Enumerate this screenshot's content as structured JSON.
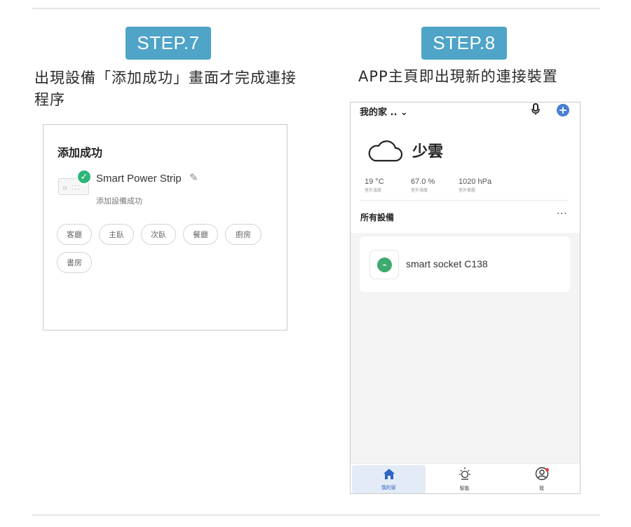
{
  "step7": {
    "badge": "STEP.7",
    "caption": "出現設備「添加成功」畫面才完成連接程序",
    "screen": {
      "title": "添加成功",
      "device_name": "Smart Power Strip",
      "device_status": "添加設備成功",
      "rooms": [
        "客廳",
        "主臥",
        "次臥",
        "餐廳",
        "廚房",
        "書房"
      ]
    }
  },
  "step8": {
    "badge": "STEP.8",
    "caption": "APP主頁即出現新的連接裝置",
    "screen": {
      "home_title": "我的家 .. ⌄",
      "weather": "少雲",
      "stats": [
        {
          "value": "19 °C",
          "label": "室外溫度"
        },
        {
          "value": "67.0 %",
          "label": "室外濕度"
        },
        {
          "value": "1020 hPa",
          "label": "室外氣壓"
        }
      ],
      "section_title": "所有設備",
      "more": "···",
      "device_name": "smart socket C138",
      "tabs": [
        {
          "label": "我的家",
          "icon": "home-icon"
        },
        {
          "label": "智能",
          "icon": "sun-icon"
        },
        {
          "label": "我",
          "icon": "profile-icon"
        }
      ]
    }
  },
  "colors": {
    "badge": "#4fa4c8",
    "accent_blue": "#4a7fd4",
    "success_green": "#2eb67a"
  }
}
